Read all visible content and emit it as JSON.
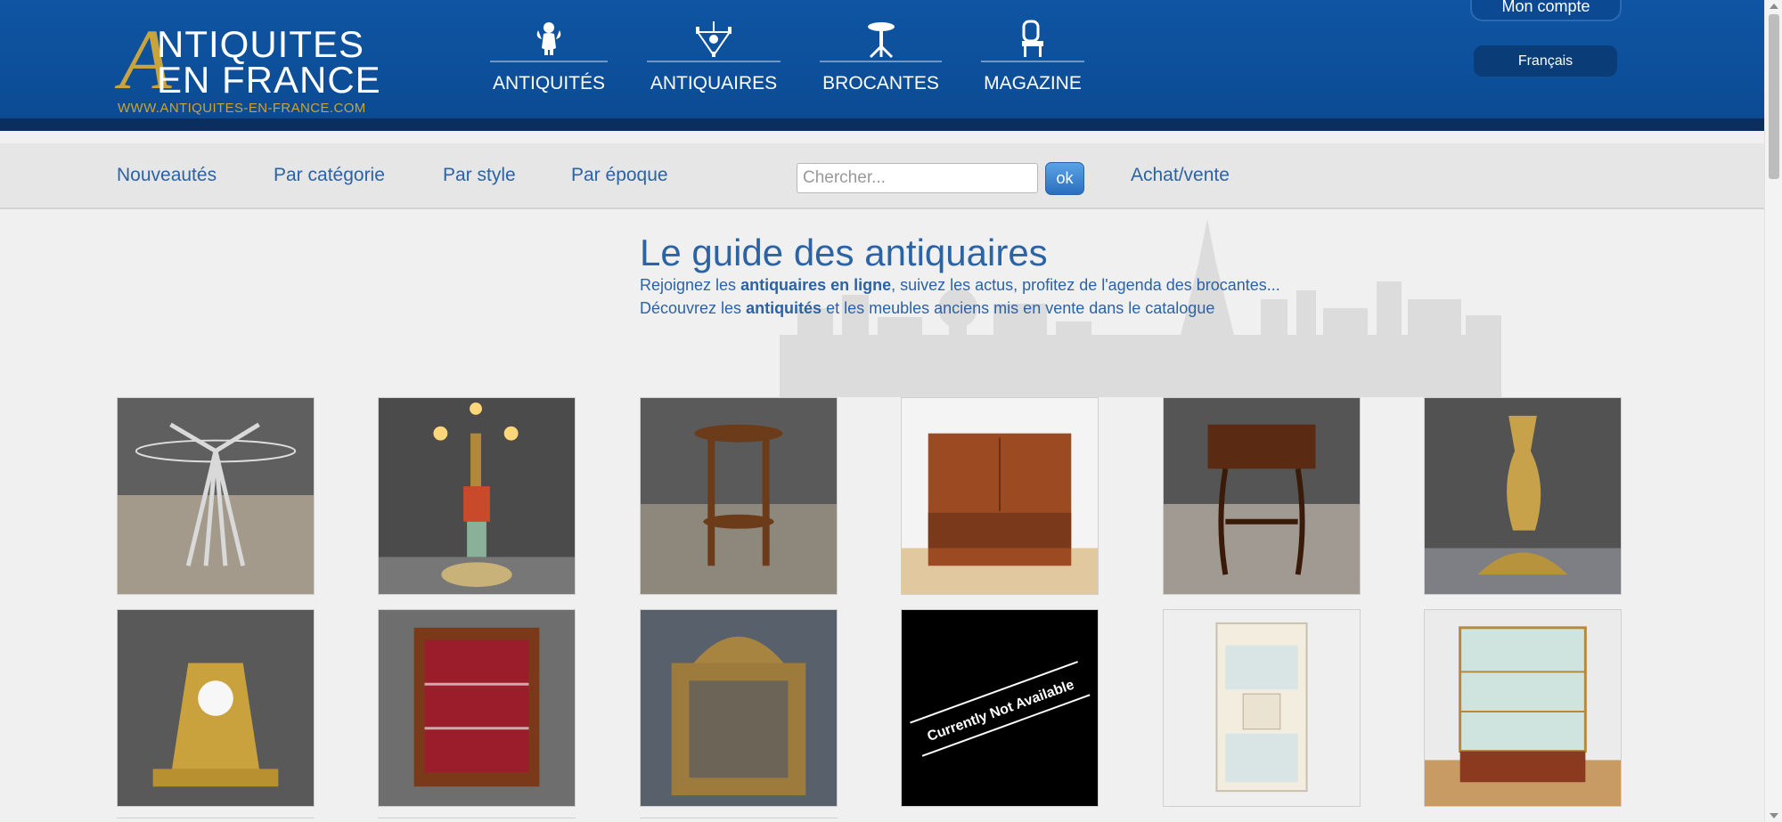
{
  "logo": {
    "big_letter": "A",
    "line1": "NTIQUITES",
    "line2": "EN FRANCE",
    "url": "WWW.ANTIQUITES-EN-FRANCE.COM"
  },
  "main_nav": [
    {
      "label": "ANTIQUITÉS",
      "icon": "cherub-icon"
    },
    {
      "label": "ANTIQUAIRES",
      "icon": "chandelier-icon"
    },
    {
      "label": "BROCANTES",
      "icon": "pedestal-table-icon"
    },
    {
      "label": "MAGAZINE",
      "icon": "chair-icon"
    }
  ],
  "account": {
    "label": "Mon compte"
  },
  "language": {
    "label": "Français"
  },
  "subnav": {
    "links": [
      "Nouveautés",
      "Par catégorie",
      "Par style",
      "Par époque"
    ],
    "search_placeholder": "Chercher...",
    "search_button": "ok",
    "extra_link": "Achat/vente"
  },
  "hero": {
    "title": "Le guide des antiquaires",
    "line1_pre": "Rejoignez les ",
    "line1_bold": "antiquaires en ligne",
    "line1_post": ", suivez les actus, profitez de l'agenda des brocantes...",
    "line2_pre": "Découvrez les ",
    "line2_bold": "antiquités",
    "line2_post": " et les meubles anciens mis en vente dans le catalogue"
  },
  "products": [
    {
      "name": "wheat-sheaf-table-image"
    },
    {
      "name": "blackamoor-lamp-image"
    },
    {
      "name": "carved-pedestal-image"
    },
    {
      "name": "teak-cabinet-image"
    },
    {
      "name": "sewing-table-image"
    },
    {
      "name": "bronze-umbrella-stand-image"
    },
    {
      "name": "gilt-mantel-clock-image"
    },
    {
      "name": "vitrine-cabinet-image"
    },
    {
      "name": "gilded-mirror-image"
    },
    {
      "name": "unavailable-image",
      "text": "Currently Not Available"
    },
    {
      "name": "medical-cabinet-image"
    },
    {
      "name": "glass-display-case-image"
    }
  ],
  "colors": {
    "header_blue": "#0f55a3",
    "link_blue": "#2b63a5",
    "gold": "#c9a33b"
  }
}
